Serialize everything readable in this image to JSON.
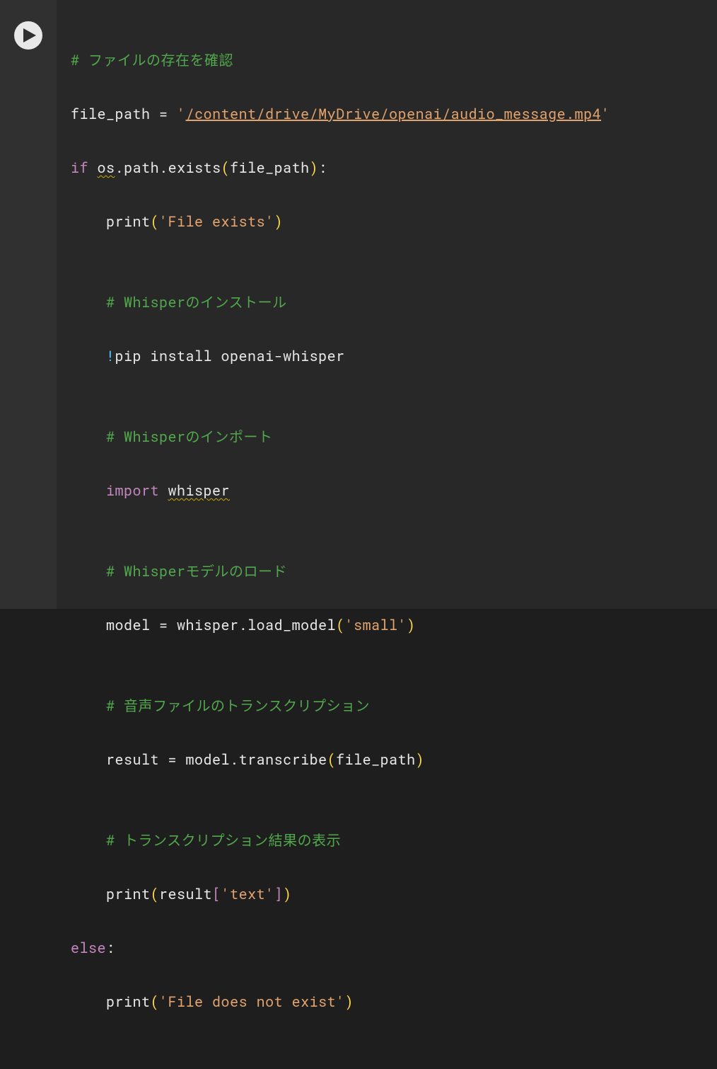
{
  "cell": {
    "lines": {
      "l1": {
        "comment": "# ファイルの存在を確認"
      },
      "l2": {
        "lhs": "file_path",
        "eq": " = ",
        "q1": "'",
        "path": "/content/drive/MyDrive/openai/audio_message.mp4",
        "q2": "'"
      },
      "l3": {
        "kw_if": "if",
        "sp": " ",
        "os": "os",
        "d1": ".",
        "path_w": "path",
        "d2": ".",
        "exists": "exists",
        "lp": "(",
        "arg": "file_path",
        "rp": ")",
        "colon": ":"
      },
      "l4": {
        "indent": "    ",
        "print": "print",
        "lp": "(",
        "str": "'File exists'",
        "rp": ")"
      },
      "l5": {
        "blank": ""
      },
      "l6": {
        "indent": "    ",
        "comment": "# Whisperのインストール"
      },
      "l7": {
        "indent": "    ",
        "bang": "!",
        "rest": "pip install openai-whisper"
      },
      "l8": {
        "blank": ""
      },
      "l9": {
        "indent": "    ",
        "comment": "# Whisperのインポート"
      },
      "l10": {
        "indent": "    ",
        "kw_import": "import",
        "sp": " ",
        "mod": "whisper"
      },
      "l11": {
        "blank": ""
      },
      "l12": {
        "indent": "    ",
        "comment": "# Whisperモデルのロード"
      },
      "l13": {
        "indent": "    ",
        "lhs": "model",
        "eq": " = ",
        "obj": "whisper",
        "dot": ".",
        "fn": "load_model",
        "lp": "(",
        "str": "'small'",
        "rp": ")"
      },
      "l14": {
        "blank": ""
      },
      "l15": {
        "indent": "    ",
        "comment": "# 音声ファイルのトランスクリプション"
      },
      "l16": {
        "indent": "    ",
        "lhs": "result",
        "eq": " = ",
        "obj": "model",
        "dot": ".",
        "fn": "transcribe",
        "lp": "(",
        "arg": "file_path",
        "rp": ")"
      },
      "l17": {
        "blank": ""
      },
      "l18": {
        "indent": "    ",
        "comment": "# トランスクリプション結果の表示"
      },
      "l19": {
        "indent": "    ",
        "print": "print",
        "lp": "(",
        "obj": "result",
        "lb": "[",
        "str": "'text'",
        "rb": "]",
        "rp": ")"
      },
      "l20": {
        "kw_else": "else",
        "colon": ":"
      },
      "l21": {
        "indent": "    ",
        "print": "print",
        "lp": "(",
        "str": "'File does not exist'",
        "rp": ")"
      }
    }
  }
}
